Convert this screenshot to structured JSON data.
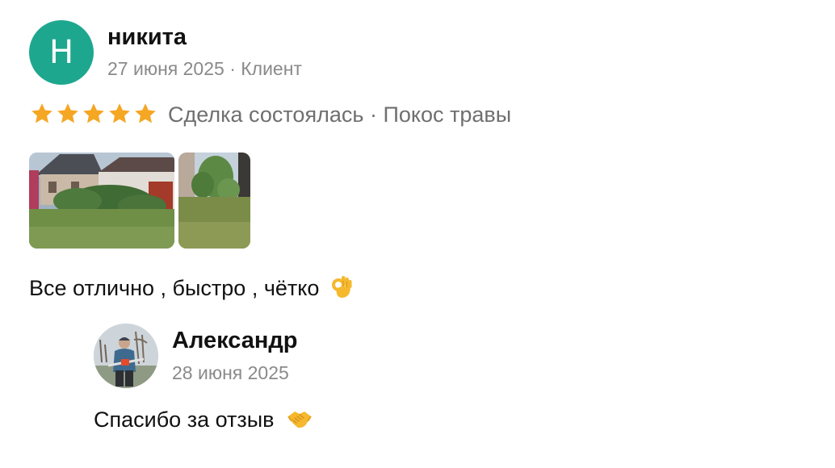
{
  "review": {
    "avatar_letter": "Н",
    "author": "никита",
    "date": "27 июня 2025",
    "separator": "·",
    "role": "Клиент",
    "rating": 5,
    "rating_max": 5,
    "deal_status": "Сделка состоялась",
    "service": "Покос травы",
    "photos": [
      "lawn-photo",
      "garden-photo"
    ],
    "text": "Все отлично , быстро , чётко",
    "emoji": "ok-hand-icon"
  },
  "reply": {
    "author": "Александр",
    "date": "28 июня 2025",
    "text": "Спасибо за отзыв",
    "emoji": "handshake-icon"
  },
  "colors": {
    "avatar_bg": "#1ea78f",
    "star": "#f5a623",
    "meta_text": "#8a8a8a",
    "deal_text": "#6f6f6f"
  }
}
